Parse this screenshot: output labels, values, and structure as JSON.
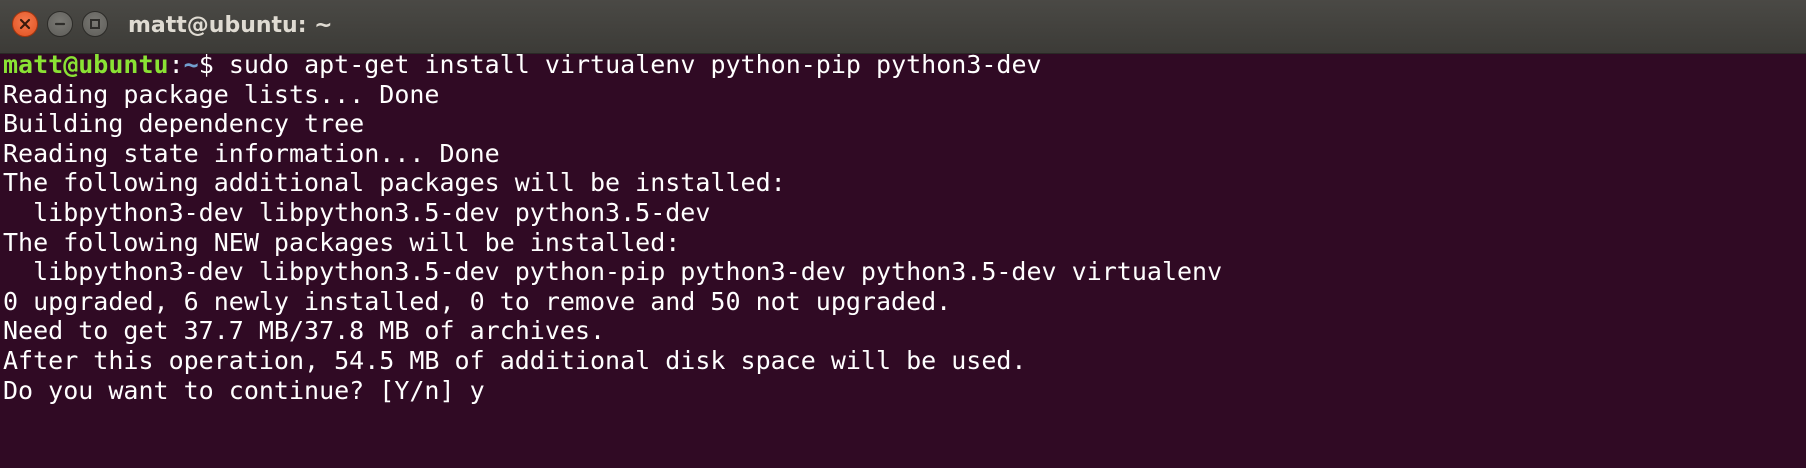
{
  "window": {
    "title": "matt@ubuntu: ~"
  },
  "prompt": {
    "user_host": "matt@ubuntu",
    "separator": ":",
    "path": "~",
    "symbol": "$ ",
    "command": "sudo apt-get install virtualenv python-pip python3-dev"
  },
  "output": [
    "Reading package lists... Done",
    "Building dependency tree",
    "Reading state information... Done",
    "The following additional packages will be installed:",
    "  libpython3-dev libpython3.5-dev python3.5-dev",
    "The following NEW packages will be installed:",
    "  libpython3-dev libpython3.5-dev python-pip python3-dev python3.5-dev virtualenv",
    "0 upgraded, 6 newly installed, 0 to remove and 50 not upgraded.",
    "Need to get 37.7 MB/37.8 MB of archives.",
    "After this operation, 54.5 MB of additional disk space will be used.",
    "Do you want to continue? [Y/n] y"
  ],
  "colors": {
    "background": "#300a24",
    "prompt_user": "#8ae234",
    "prompt_path": "#729fcf",
    "text": "#ffffff"
  },
  "icons": {
    "close": "close-icon",
    "minimize": "minimize-icon",
    "maximize": "maximize-icon"
  }
}
